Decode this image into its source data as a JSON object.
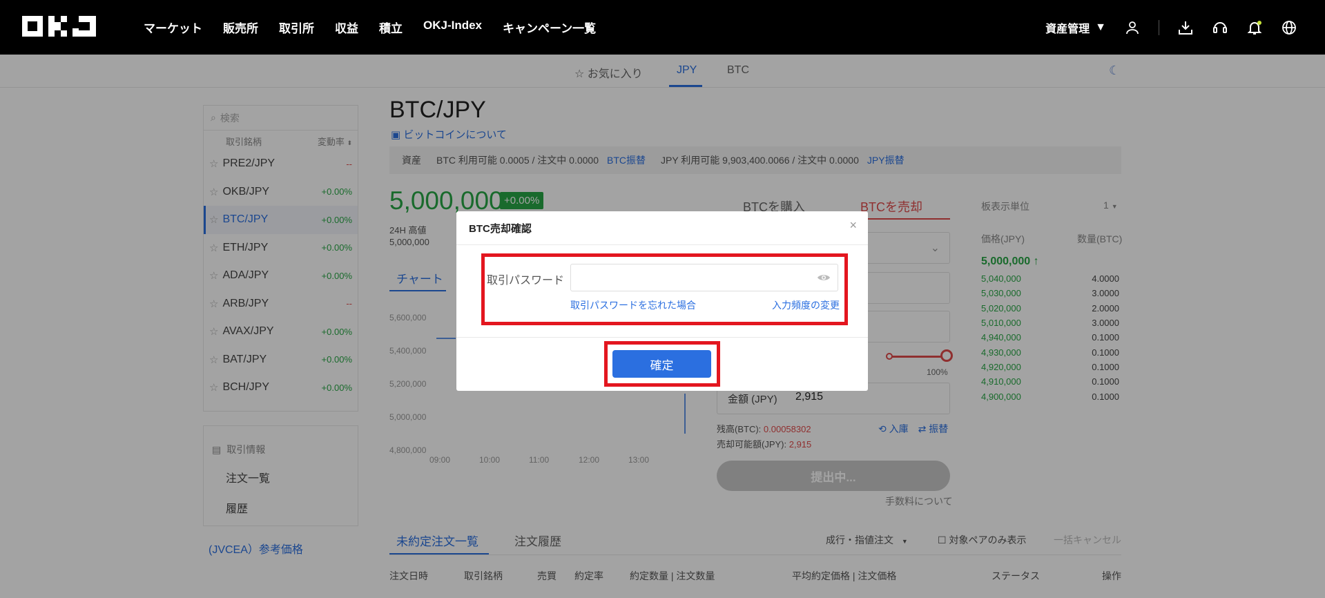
{
  "header": {
    "nav": [
      "マーケット",
      "販売所",
      "取引所",
      "収益",
      "積立",
      "OKJ-Index",
      "キャンペーン一覧"
    ],
    "asset_menu": "資産管理"
  },
  "subnav": {
    "favorites": "お気に入り",
    "jpy": "JPY",
    "btc": "BTC"
  },
  "sidebar": {
    "search_placeholder": "検索",
    "col_pair": "取引銘柄",
    "col_change": "変動率",
    "pairs": [
      {
        "name": "PRE2/JPY",
        "change": "--"
      },
      {
        "name": "OKB/JPY",
        "change": "+0.00%"
      },
      {
        "name": "BTC/JPY",
        "change": "+0.00%"
      },
      {
        "name": "ETH/JPY",
        "change": "+0.00%"
      },
      {
        "name": "ADA/JPY",
        "change": "+0.00%"
      },
      {
        "name": "ARB/JPY",
        "change": "--"
      },
      {
        "name": "AVAX/JPY",
        "change": "+0.00%"
      },
      {
        "name": "BAT/JPY",
        "change": "+0.00%"
      },
      {
        "name": "BCH/JPY",
        "change": "+0.00%"
      }
    ],
    "info_title": "取引情報",
    "order_list": "注文一覧",
    "history": "履歴",
    "jvcea": "(JVCEA）参考価格"
  },
  "main": {
    "pair": "BTC/JPY",
    "about": "ビットコインについて",
    "asset_label": "資産",
    "btc_assets": "BTC  利用可能 0.0005 / 注文中 0.0000",
    "btc_transfer": "BTC振替",
    "jpy_assets": "JPY  利用可能 9,903,400.0066 / 注文中 0.0000",
    "jpy_transfer": "JPY振替",
    "price": "5,000,000",
    "change_badge": "+0.00%",
    "high_label": "24H 高値",
    "high_value": "5,000,000",
    "chart_tab": "チャート",
    "y_ticks": [
      "5,600,000",
      "5,400,000",
      "5,200,000",
      "5,000,000",
      "4,800,000"
    ],
    "x_ticks": [
      "09:00",
      "10:00",
      "11:00",
      "12:00",
      "13:00"
    ]
  },
  "order": {
    "buy_tab": "BTCを購入",
    "sell_tab": "BTCを売却",
    "slider_pct": "100%",
    "amount_label": "金額 (JPY)",
    "amount_value": "2,915",
    "balance_label": "残高(BTC): ",
    "balance_value": "0.00058302",
    "sellable_label": "売却可能額(JPY): ",
    "sellable_value": "2,915",
    "deposit": "入庫",
    "transfer": "振替",
    "submit": "提出中...",
    "fee_link": "手数料について"
  },
  "orderbook": {
    "unit_label": "板表示単位",
    "unit_value": "1",
    "price_head": "価格(JPY)",
    "qty_head": "数量(BTC)",
    "current": "5,000,000",
    "rows": [
      {
        "price": "5,040,000",
        "qty": "4.0000"
      },
      {
        "price": "5,030,000",
        "qty": "3.0000"
      },
      {
        "price": "5,020,000",
        "qty": "2.0000"
      },
      {
        "price": "5,010,000",
        "qty": "3.0000"
      },
      {
        "price": "4,940,000",
        "qty": "0.1000"
      },
      {
        "price": "4,930,000",
        "qty": "0.1000"
      },
      {
        "price": "4,920,000",
        "qty": "0.1000"
      },
      {
        "price": "4,910,000",
        "qty": "0.1000"
      },
      {
        "price": "4,900,000",
        "qty": "0.1000"
      }
    ]
  },
  "orders": {
    "tab_open": "未約定注文一覧",
    "tab_history": "注文履歴",
    "filter_type": "成行・指値注文",
    "filter_pair": "対象ペアのみ表示",
    "cancel_all": "一括キャンセル",
    "columns": [
      "注文日時",
      "取引銘柄",
      "売買",
      "約定率",
      "約定数量 | 注文数量",
      "平均約定価格 | 注文価格",
      "ステータス",
      "操作"
    ]
  },
  "modal": {
    "title": "BTC売却確認",
    "close": "×",
    "password_label": "取引パスワード",
    "password_value": "",
    "forgot_link": "取引パスワードを忘れた場合",
    "frequency_link": "入力頻度の変更",
    "confirm": "確定"
  },
  "colors": {
    "accent": "#2b6fe0",
    "positive": "#28a745",
    "negative": "#e04a4a",
    "highlight_box": "#e3161f"
  }
}
